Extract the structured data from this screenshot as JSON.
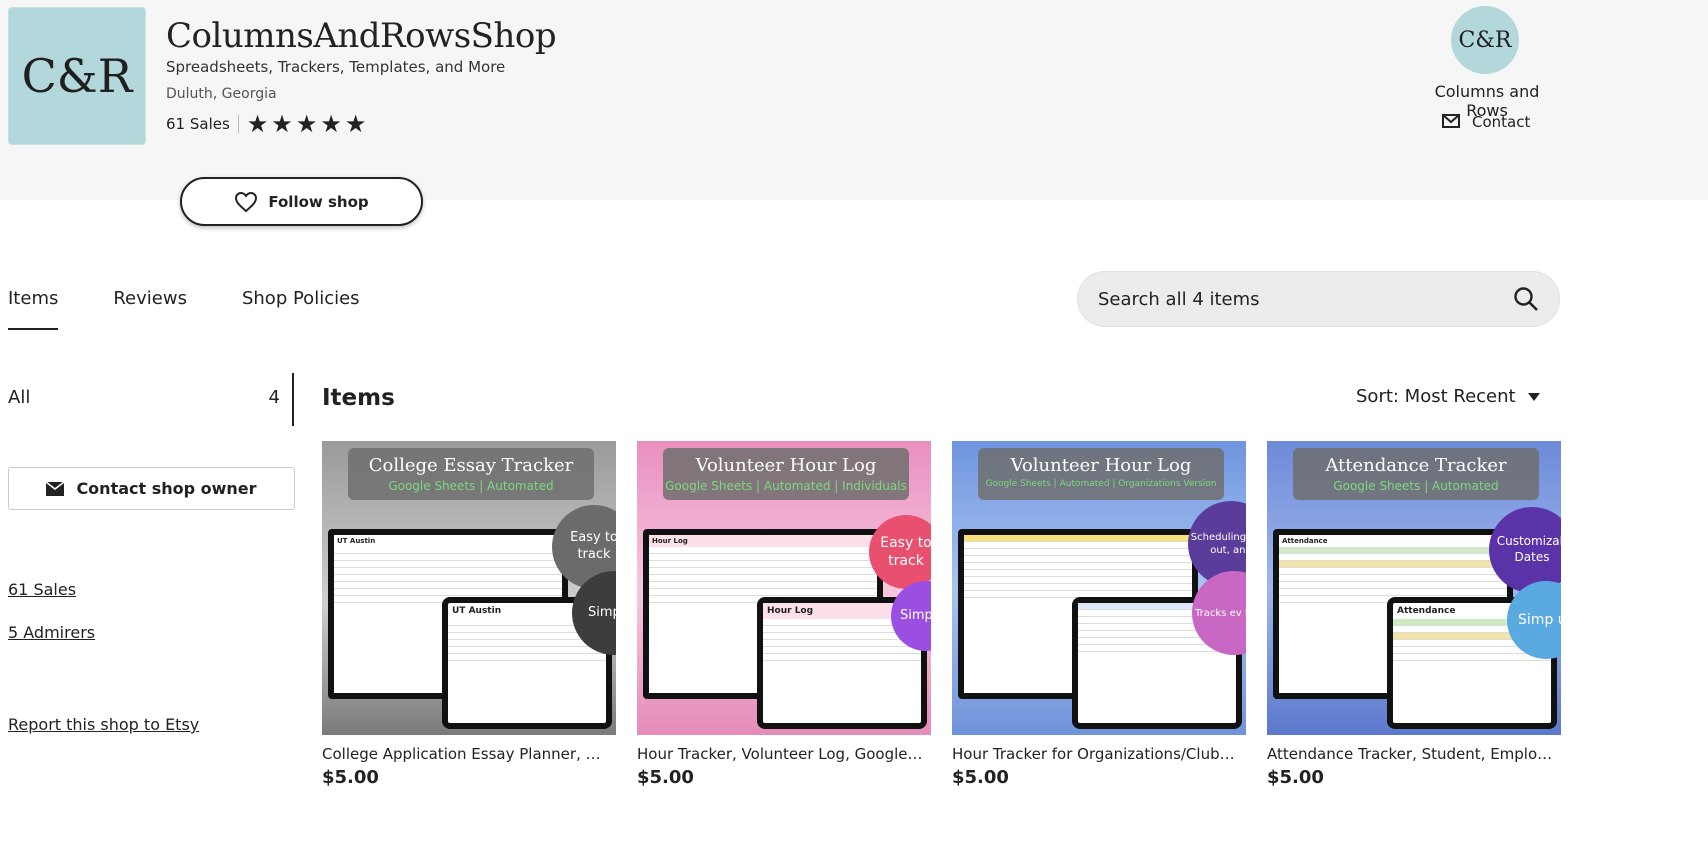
{
  "shop": {
    "logo_text": "C&R",
    "name": "ColumnsAndRowsShop",
    "tagline": "Spreadsheets, Trackers, Templates, and More",
    "location": "Duluth, Georgia",
    "sales": "61 Sales",
    "rating_stars": 5,
    "follow_label": "Follow shop"
  },
  "owner": {
    "avatar_text": "C&R",
    "name": "Columns and Rows",
    "contact_label": "Contact"
  },
  "tabs": [
    {
      "label": "Items",
      "active": true
    },
    {
      "label": "Reviews",
      "active": false
    },
    {
      "label": "Shop Policies",
      "active": false
    }
  ],
  "search": {
    "placeholder": "Search all 4 items"
  },
  "sidebar": {
    "all_label": "All",
    "all_count": "4",
    "contact_owner_label": "Contact shop owner",
    "sales_link": "61 Sales",
    "admirers_link": "5 Admirers",
    "report_link": "Report this shop to Etsy"
  },
  "main": {
    "title": "Items",
    "sort_label": "Sort: Most Recent"
  },
  "items": [
    {
      "title": "College Application Essay Planner, Or...",
      "price": "$5.00",
      "banner_title": "College Essay Tracker",
      "banner_sub": "Google Sheets | Automated",
      "bg": "#8c8c8c",
      "bubble1": "Easy to track",
      "bubble2": "Simp us",
      "sheet_title": "UT Austin"
    },
    {
      "title": "Hour Tracker, Volunteer Log, Google S...",
      "price": "$5.00",
      "banner_title": "Volunteer Hour Log",
      "banner_sub": "Google Sheets | Automated | Individuals",
      "bg": "#e88fbd",
      "bubble1": "Easy to track",
      "bubble2": "Simp us",
      "sheet_title": "Hour Log"
    },
    {
      "title": "Hour Tracker for Organizations/Clubs, ...",
      "price": "$5.00",
      "banner_title": "Volunteer Hour Log",
      "banner_sub": "Google Sheets | Automated | Organizations Version",
      "bg": "#7f9fe0",
      "bubble1": "Scheduling, and out, and",
      "bubble2": "Tracks ev hours",
      "sheet_title": ""
    },
    {
      "title": "Attendance Tracker, Student, Employe...",
      "price": "$5.00",
      "banner_title": "Attendance Tracker",
      "banner_sub": "Google Sheets | Automated",
      "bg": "#6f8fd8",
      "bubble1": "Customizab Dates",
      "bubble2": "Simp us",
      "sheet_title": "Attendance"
    }
  ]
}
